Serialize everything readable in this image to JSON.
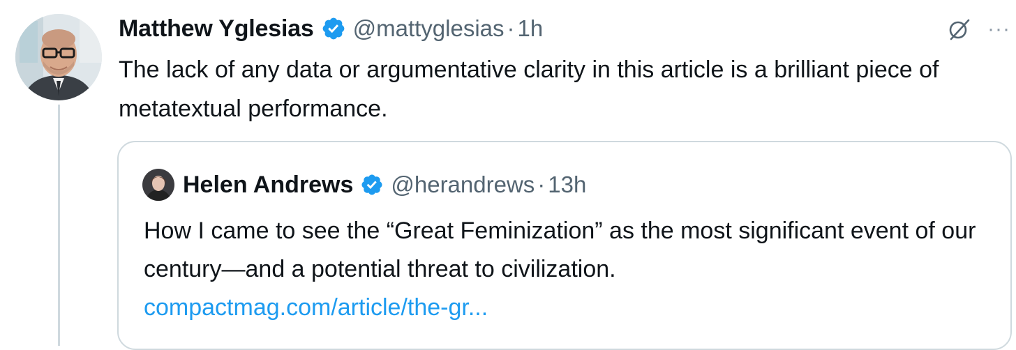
{
  "tweet": {
    "author": {
      "name": "Matthew Yglesias",
      "handle": "@mattyglesias",
      "time": "1h",
      "verified": true
    },
    "separator": "·",
    "text": "The lack of any data or argumentative clarity in this article is a brilliant piece of metatextual performance.",
    "more_label": "···"
  },
  "quote": {
    "author": {
      "name": "Helen Andrews",
      "handle": "@herandrews",
      "time": "13h",
      "verified": true
    },
    "separator": "·",
    "text": "How I came to see the “Great Feminization” as the most significant event of our century—and a potential threat to civilization.",
    "link": "compactmag.com/article/the-gr..."
  },
  "colors": {
    "verified_badge": "#1d9bf0",
    "link": "#1d9bf0",
    "secondary_text": "#536471",
    "border": "#cfd9de"
  }
}
